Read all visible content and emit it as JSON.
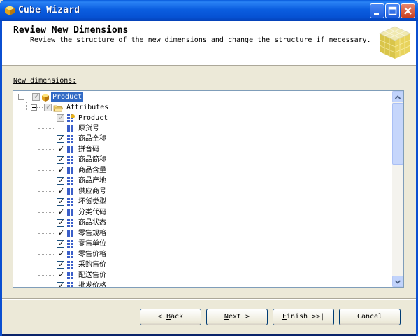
{
  "window": {
    "title": "Cube Wizard"
  },
  "header": {
    "title": "Review New Dimensions",
    "subtitle": "Review the structure of the new dimensions and change the structure if necessary."
  },
  "main": {
    "label": "New dimensions:"
  },
  "tree": {
    "root": "Product",
    "attributes_folder": "Attributes",
    "items": [
      {
        "label": "Product",
        "checked": true,
        "disabled": true
      },
      {
        "label": "原货号",
        "checked": false
      },
      {
        "label": "商品全称",
        "checked": true
      },
      {
        "label": "拼音码",
        "checked": true
      },
      {
        "label": "商品简称",
        "checked": true
      },
      {
        "label": "商品含量",
        "checked": true
      },
      {
        "label": "商品产地",
        "checked": true
      },
      {
        "label": "供应商号",
        "checked": true
      },
      {
        "label": "坏货类型",
        "checked": true
      },
      {
        "label": "分类代码",
        "checked": true
      },
      {
        "label": "商品状态",
        "checked": true
      },
      {
        "label": "零售规格",
        "checked": true
      },
      {
        "label": "零售单位",
        "checked": true
      },
      {
        "label": "零售价格",
        "checked": true
      },
      {
        "label": "采购售价",
        "checked": true
      },
      {
        "label": "配送售价",
        "checked": true
      },
      {
        "label": "批发价格",
        "checked": true
      }
    ]
  },
  "buttons": {
    "back": {
      "prefix": "< ",
      "mnemonic": "B",
      "rest": "ack"
    },
    "next": {
      "mnemonic": "N",
      "rest": "ext >"
    },
    "finish": {
      "mnemonic": "F",
      "rest": "inish >>|"
    },
    "cancel": "Cancel"
  }
}
